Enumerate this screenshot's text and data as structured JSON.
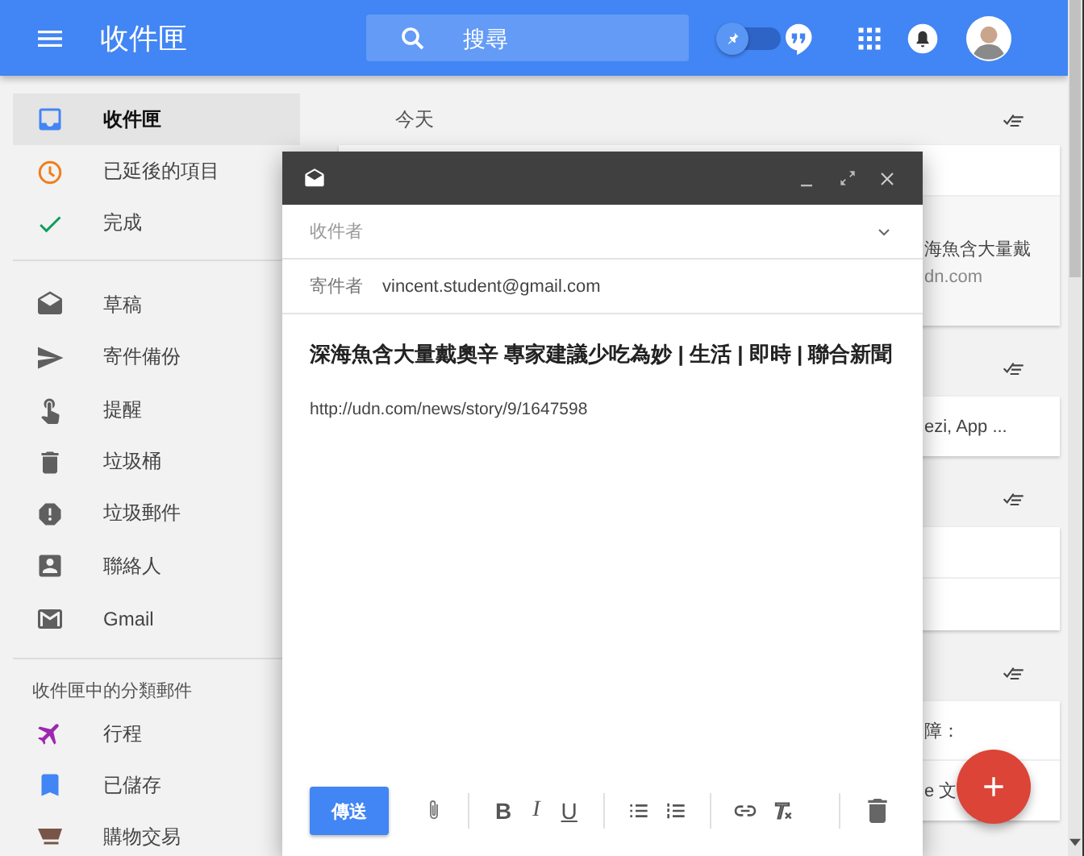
{
  "app_bar": {
    "title": "收件匣",
    "search": {
      "placeholder": "搜尋"
    },
    "pin_toggle": {
      "on": false
    }
  },
  "sidebar": {
    "items": [
      {
        "kind": "inbox",
        "label": "收件匣",
        "selected": true
      },
      {
        "kind": "snoozed",
        "label": "已延後的項目",
        "selected": false
      },
      {
        "kind": "done",
        "label": "完成",
        "selected": false
      },
      {
        "kind": "drafts",
        "label": "草稿",
        "selected": false
      },
      {
        "kind": "sent",
        "label": "寄件備份",
        "selected": false
      },
      {
        "kind": "reminders",
        "label": "提醒",
        "selected": false
      },
      {
        "kind": "trash",
        "label": "垃圾桶",
        "selected": false
      },
      {
        "kind": "spam",
        "label": "垃圾郵件",
        "selected": false
      },
      {
        "kind": "contacts",
        "label": "聯絡人",
        "selected": false
      },
      {
        "kind": "gmail",
        "label": "Gmail",
        "selected": false
      }
    ],
    "section_title": "收件匣中的分類郵件",
    "bundles": [
      {
        "kind": "travel",
        "label": "行程",
        "selected": false
      },
      {
        "kind": "saved",
        "label": "已儲存",
        "selected": false
      },
      {
        "kind": "purchases",
        "label": "購物交易",
        "selected": false
      }
    ]
  },
  "main": {
    "sections": [
      {
        "heading": "今天",
        "cards": [
          {
            "rows": [
              {
                "kind": "blank"
              },
              {
                "kind": "expanded",
                "lines": [
                  "海魚含大量戴",
                  "dn.com"
                ]
              }
            ]
          }
        ]
      },
      {
        "cards": [
          {
            "rows": [
              {
                "kind": "text",
                "lines": [
                  "ezi, App ..."
                ]
              }
            ]
          }
        ]
      },
      {
        "cards": [
          {
            "rows": [
              {
                "kind": "blank"
              },
              {
                "kind": "blank"
              }
            ]
          }
        ]
      },
      {
        "cards": [
          {
            "rows": [
              {
                "kind": "text",
                "lines": [
                  "障："
                ]
              },
              {
                "kind": "text",
                "lines": [
                  "e 文"
                ]
              }
            ]
          }
        ]
      }
    ]
  },
  "compose": {
    "to": {
      "placeholder": "收件者"
    },
    "from_label": "寄件者",
    "from_value": "vincent.student@gmail.com",
    "subject": "深海魚含大量戴奧辛 專家建議少吃為妙 | 生活 | 即時 | 聯合新聞",
    "body": "http://udn.com/news/story/9/1647598",
    "send_label": "傳送",
    "format_buttons": [
      {
        "kind": "bold",
        "label": "B"
      },
      {
        "kind": "italic",
        "label": "I"
      },
      {
        "kind": "underline",
        "label": "U"
      }
    ]
  }
}
